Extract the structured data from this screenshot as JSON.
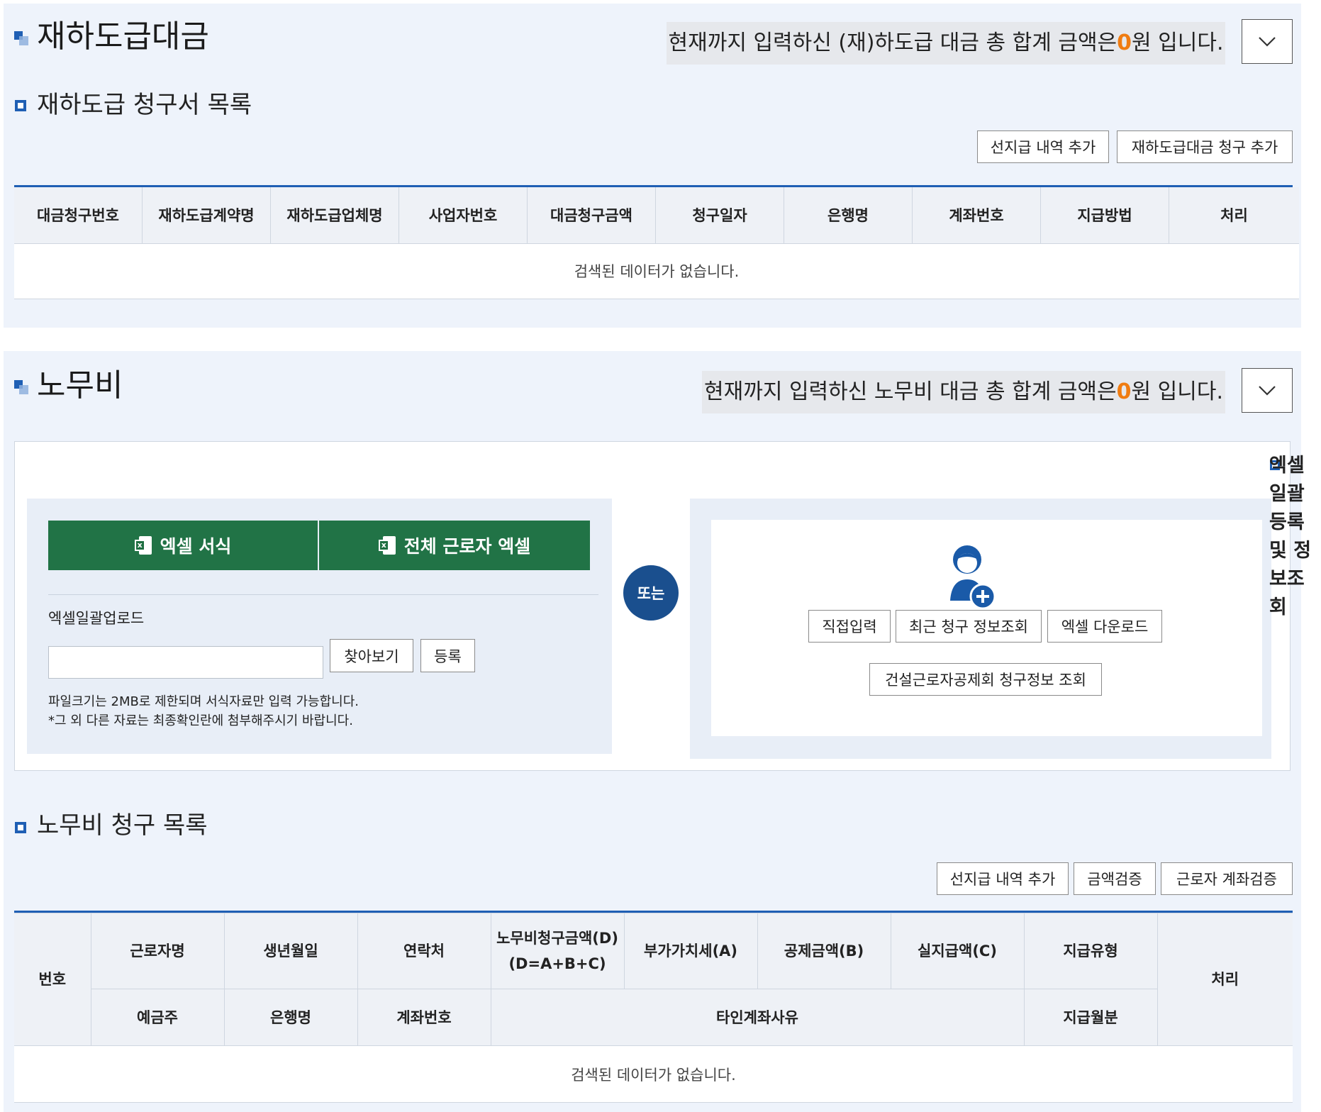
{
  "subcontract": {
    "title": "재하도급대금",
    "total_prefix": "현재까지 입력하신 (재)하도급 대금 총 합계 금액은 ",
    "total_amount": "0",
    "total_suffix": "원 입니다.",
    "list_title": "재하도급 청구서 목록",
    "buttons": {
      "add_prepay": "선지급 내역 추가",
      "add_claim": "재하도급대금 청구 추가"
    },
    "columns": [
      "대금청구번호",
      "재하도급계약명",
      "재하도급업체명",
      "사업자번호",
      "대금청구금액",
      "청구일자",
      "은행명",
      "계좌번호",
      "지급방법",
      "처리"
    ],
    "empty_message": "검색된 데이터가 없습니다."
  },
  "labor": {
    "title": "노무비",
    "total_prefix": "현재까지 입력하신 노무비 대금 총 합계 금액은 ",
    "total_amount": "0",
    "total_suffix": "원 입니다.",
    "excel_template_label": "엑셀 서식",
    "all_workers_excel_label": "전체 근로자 엑셀",
    "upload_label": "엑셀일괄업로드",
    "browse_label": "찾아보기",
    "register_label": "등록",
    "note_line1": "파일크기는 2MB로 제한되며 서식자료만 입력 가능합니다.",
    "note_line2": "*그 외 다른 자료는 최종확인란에 첨부해주시기 바랍니다.",
    "or_label": "또는",
    "direct_input_label": "직접입력",
    "recent_claim_label": "최근 청구 정보조회",
    "excel_download_label": "엑셀 다운로드",
    "cwma_label": "건설근로자공제회 청구정보 조회",
    "side_title": "엑셀일괄등록 및 정보조회",
    "list_title": "노무비 청구 목록",
    "buttons": {
      "add_prepay": "선지급 내역 추가",
      "verify_amount": "금액검증",
      "verify_account": "근로자 계좌검증"
    },
    "columns": {
      "no": "번호",
      "worker": "근로자명",
      "birth": "생년월일",
      "contact": "연락처",
      "labor_amount_line1": "노무비청구금액(D)",
      "labor_amount_line2": "(D=A+B+C)",
      "vat": "부가가치세(A)",
      "deduction": "공제금액(B)",
      "actual_pay": "실지급액(C)",
      "pay_type": "지급유형",
      "process": "처리",
      "depositor": "예금주",
      "bank": "은행명",
      "account": "계좌번호",
      "other_account_reason": "타인계좌사유",
      "pay_month": "지급월분"
    },
    "empty_message": "검색된 데이터가 없습니다."
  },
  "colors": {
    "accent_blue": "#1f5fb4",
    "excel_green": "#217346",
    "amount_orange": "#f07c11",
    "or_circle": "#1a4f8e"
  },
  "icons": {
    "section": "section-title-icon",
    "toggle": "chevron-down-icon",
    "excel": "excel-icon",
    "add_person": "add-person-icon"
  }
}
